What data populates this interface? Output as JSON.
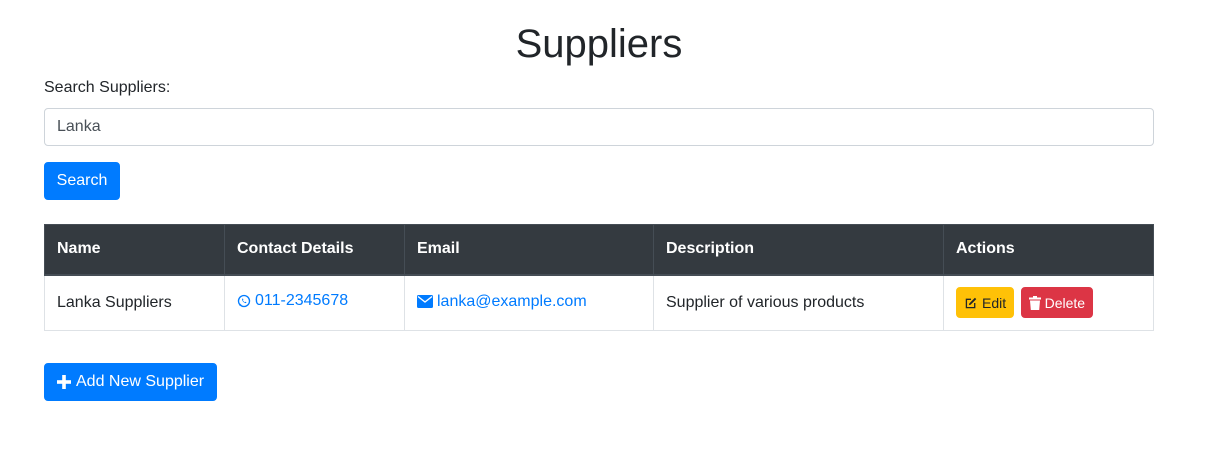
{
  "page": {
    "title": "Suppliers"
  },
  "search": {
    "label": "Search Suppliers:",
    "value": "Lanka",
    "placeholder": "",
    "button_label": "Search"
  },
  "table": {
    "headers": [
      "Name",
      "Contact Details",
      "Email",
      "Description",
      "Actions"
    ],
    "rows": [
      {
        "name": "Lanka Suppliers",
        "contact": "011-2345678",
        "contact_icon": "whatsapp-icon",
        "email": "lanka@example.com",
        "email_icon": "envelope-icon",
        "description": "Supplier of various products",
        "edit_label": "Edit",
        "delete_label": "Delete"
      }
    ]
  },
  "actions": {
    "add_label": "Add New Supplier",
    "add_icon": "plus-icon"
  },
  "colors": {
    "primary": "#007bff",
    "warning": "#ffc107",
    "danger": "#dc3545",
    "table_header": "#343a40"
  }
}
